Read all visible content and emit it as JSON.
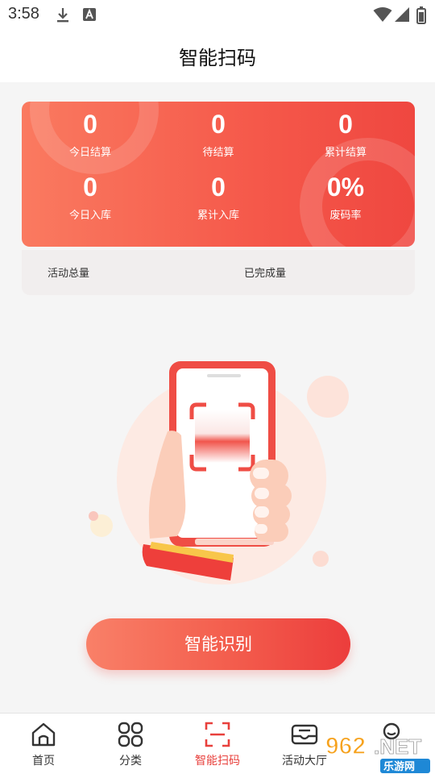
{
  "status_bar": {
    "time": "3:58"
  },
  "header": {
    "title": "智能扫码"
  },
  "stats": [
    {
      "value": "0",
      "label": "今日结算"
    },
    {
      "value": "0",
      "label": "待结算"
    },
    {
      "value": "0",
      "label": "累计结算"
    },
    {
      "value": "0",
      "label": "今日入库"
    },
    {
      "value": "0",
      "label": "累计入库"
    },
    {
      "value": "0%",
      "label": "废码率"
    }
  ],
  "activity": {
    "total_label": "活动总量",
    "completed_label": "已完成量"
  },
  "scan_button": {
    "label": "智能识别"
  },
  "tabs": [
    {
      "label": "首页",
      "icon": "home-icon",
      "active": false
    },
    {
      "label": "分类",
      "icon": "grid-icon",
      "active": false
    },
    {
      "label": "智能扫码",
      "icon": "scan-icon",
      "active": true
    },
    {
      "label": "活动大厅",
      "icon": "mail-icon",
      "active": false
    },
    {
      "label": "",
      "icon": "user-icon",
      "active": false
    }
  ],
  "watermark": {
    "number": "962",
    "suffix": ".NET",
    "subtitle": "乐游网"
  },
  "colors": {
    "accent": "#ef4740",
    "accent_light": "#fa7a60",
    "active_tab": "#e8403c"
  }
}
